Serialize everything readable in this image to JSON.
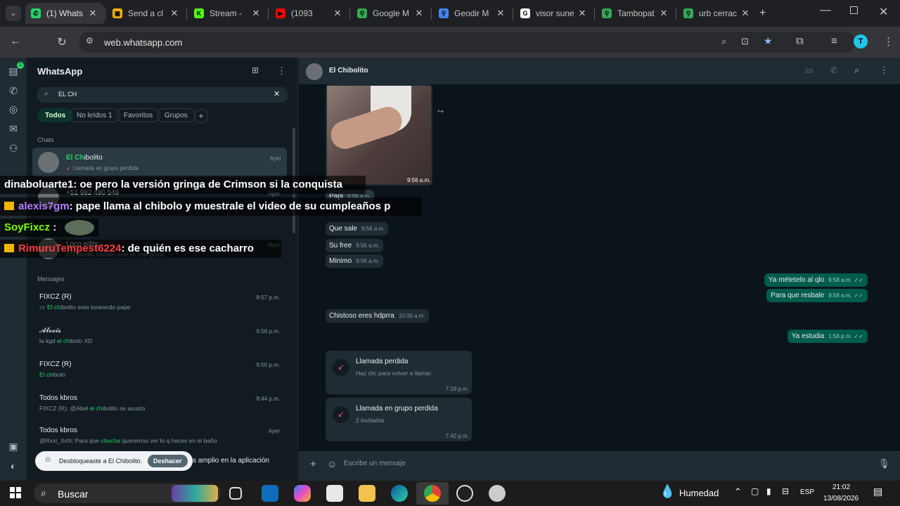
{
  "browser": {
    "tabs": [
      {
        "title": "(1) Whats",
        "color": "#25d366",
        "glyph": "✆"
      },
      {
        "title": "Send a cl",
        "color": "#f4b400",
        "glyph": "▣"
      },
      {
        "title": "Stream - ",
        "color": "#53fc18",
        "glyph": "K"
      },
      {
        "title": "(1093",
        "color": "#ff0000",
        "glyph": "▶"
      },
      {
        "title": "Google M",
        "color": "#34a853",
        "glyph": "⚲"
      },
      {
        "title": "Geodir M",
        "color": "#4285f4",
        "glyph": "⚲"
      },
      {
        "title": "visor sune",
        "color": "#ffffff",
        "glyph": "G"
      },
      {
        "title": "Tambopat",
        "color": "#34a853",
        "glyph": "⚲"
      },
      {
        "title": "urb cerrac",
        "color": "#34a853",
        "glyph": "⚲"
      }
    ],
    "url": "web.whatsapp.com",
    "profile_initial": "T"
  },
  "wa": {
    "app_title": "WhatsApp",
    "search_value": "EL CH",
    "filters": [
      "Todos",
      "No leídos 1",
      "Favoritos",
      "Grupos"
    ],
    "section_chats": "Chats",
    "section_messages": "Mensajes",
    "chats": [
      {
        "name_hl": "El Ch",
        "name_rest": "ibolito",
        "sub": "Llamada en grupo perdida",
        "time": "Ayer"
      },
      {
        "name": "+51 982 490 549",
        "sub": "",
        "time": "Ayer"
      },
      {
        "name": "Loco edits",
        "sub_hl": "El Ch",
        "sub_rest": "ibolito también está en este grupo.",
        "time": "Ayer"
      }
    ],
    "messages": [
      {
        "name": "FIXCZ (R)",
        "sub_pre": "",
        "sub_hl": "El ch",
        "sub_rest": "ibolito esta toneando pape",
        "time": "8:57 p.m.",
        "video": true
      },
      {
        "name": "𝓐𝓵𝓮𝔁𝓲𝓼",
        "sub_pre": "la kgd ",
        "sub_hl": "el ch",
        "sub_rest": "ibolo XD",
        "time": "8:56 p.m."
      },
      {
        "name": "FIXCZ (R)",
        "sub_pre": "",
        "sub_hl": "El ch",
        "sub_rest": "ibolo",
        "time": "8:50 p.m."
      },
      {
        "name": "Todos kbros",
        "sub_pre": "FIXCZ (R): @Abel ",
        "sub_hl": "el ch",
        "sub_rest": "ibolito se asusto",
        "time": "8:44 p.m."
      },
      {
        "name": "Todos kbros",
        "sub_pre": "@Rxxi_XcN: Para que ",
        "sub_hl": "chucha",
        "sub_rest": " queremos ver lo q haces en el baño",
        "time": "Ayer"
      }
    ],
    "toast": {
      "text": "Desbloqueaste a El Chibolito.",
      "button": "Deshacer",
      "behind": "s amplio en la aplicación"
    },
    "chat_name": "El Chibolito",
    "photo_time": "9:56 a.m.",
    "incoming": [
      {
        "text": "Papi",
        "time": "9:56 a.m."
      },
      {
        "text": "Que sale",
        "time": "9:56 a.m."
      },
      {
        "text": "Su free",
        "time": "9:56 a.m."
      },
      {
        "text": "Minimo",
        "time": "9:56 a.m."
      },
      {
        "text": "Chistoso eres hdprra",
        "time": "10:00 a.m."
      }
    ],
    "outgoing": [
      {
        "text": "Ya métetelo al qlo",
        "time": "9:58 a.m."
      },
      {
        "text": "Para que resbale",
        "time": "9:58 a.m."
      },
      {
        "text": "Ya estudia",
        "time": "1:56 p.m."
      }
    ],
    "calls": [
      {
        "title": "Llamada perdida",
        "sub": "Haz clic para volver a llamar.",
        "time": "7:18 p.m."
      },
      {
        "title": "Llamada en grupo perdida",
        "sub": "2 invitados",
        "time": "7:42 p.m."
      }
    ],
    "compose_placeholder": "Escribe un mensaje"
  },
  "overlay": [
    {
      "user": "dinaboluarte1",
      "text": ": oe pero la versión gringa de Crimson si la conquista",
      "color": "#ffffff",
      "badge": false
    },
    {
      "user": "alexis7gm",
      "text": ": pape llama al chibolo y muestrale el video de su cumpleaños p",
      "color": "#b77bff",
      "badge": true
    },
    {
      "user": "SoyFixcz",
      "text": " :",
      "color": "#7fff00",
      "badge": false
    },
    {
      "user": "RimuruTempest6224",
      "text": ": de quién es ese cacharro",
      "color": "#ff3c3c",
      "badge": true
    }
  ],
  "taskbar": {
    "search": "Buscar",
    "weather": "Humedad",
    "lang": "ESP",
    "time": "21:02",
    "date": "13/08/2026"
  }
}
